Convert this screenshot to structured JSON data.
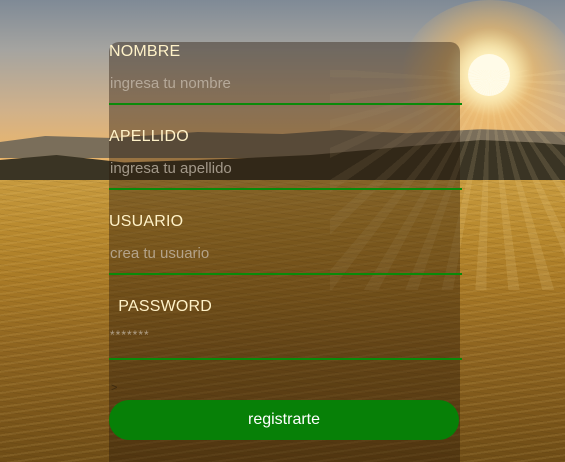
{
  "form": {
    "fields": [
      {
        "label": "NOMBRE",
        "placeholder": "ingresa tu nombre",
        "value": ""
      },
      {
        "label": "APELLIDO",
        "placeholder": "ingresa tu apellido",
        "value": ""
      },
      {
        "label": "USUARIO",
        "placeholder": "crea tu usuario",
        "value": ""
      },
      {
        "label": "  PASSWORD",
        "placeholder": "*******",
        "value": ""
      }
    ],
    "small_text": ">",
    "submit_label": "registrarte"
  },
  "colors": {
    "accent": "#078007",
    "underline": "#0a8a0a",
    "label_text": "#fff2c8",
    "panel_overlay": "rgba(40,25,10,0.42)"
  }
}
